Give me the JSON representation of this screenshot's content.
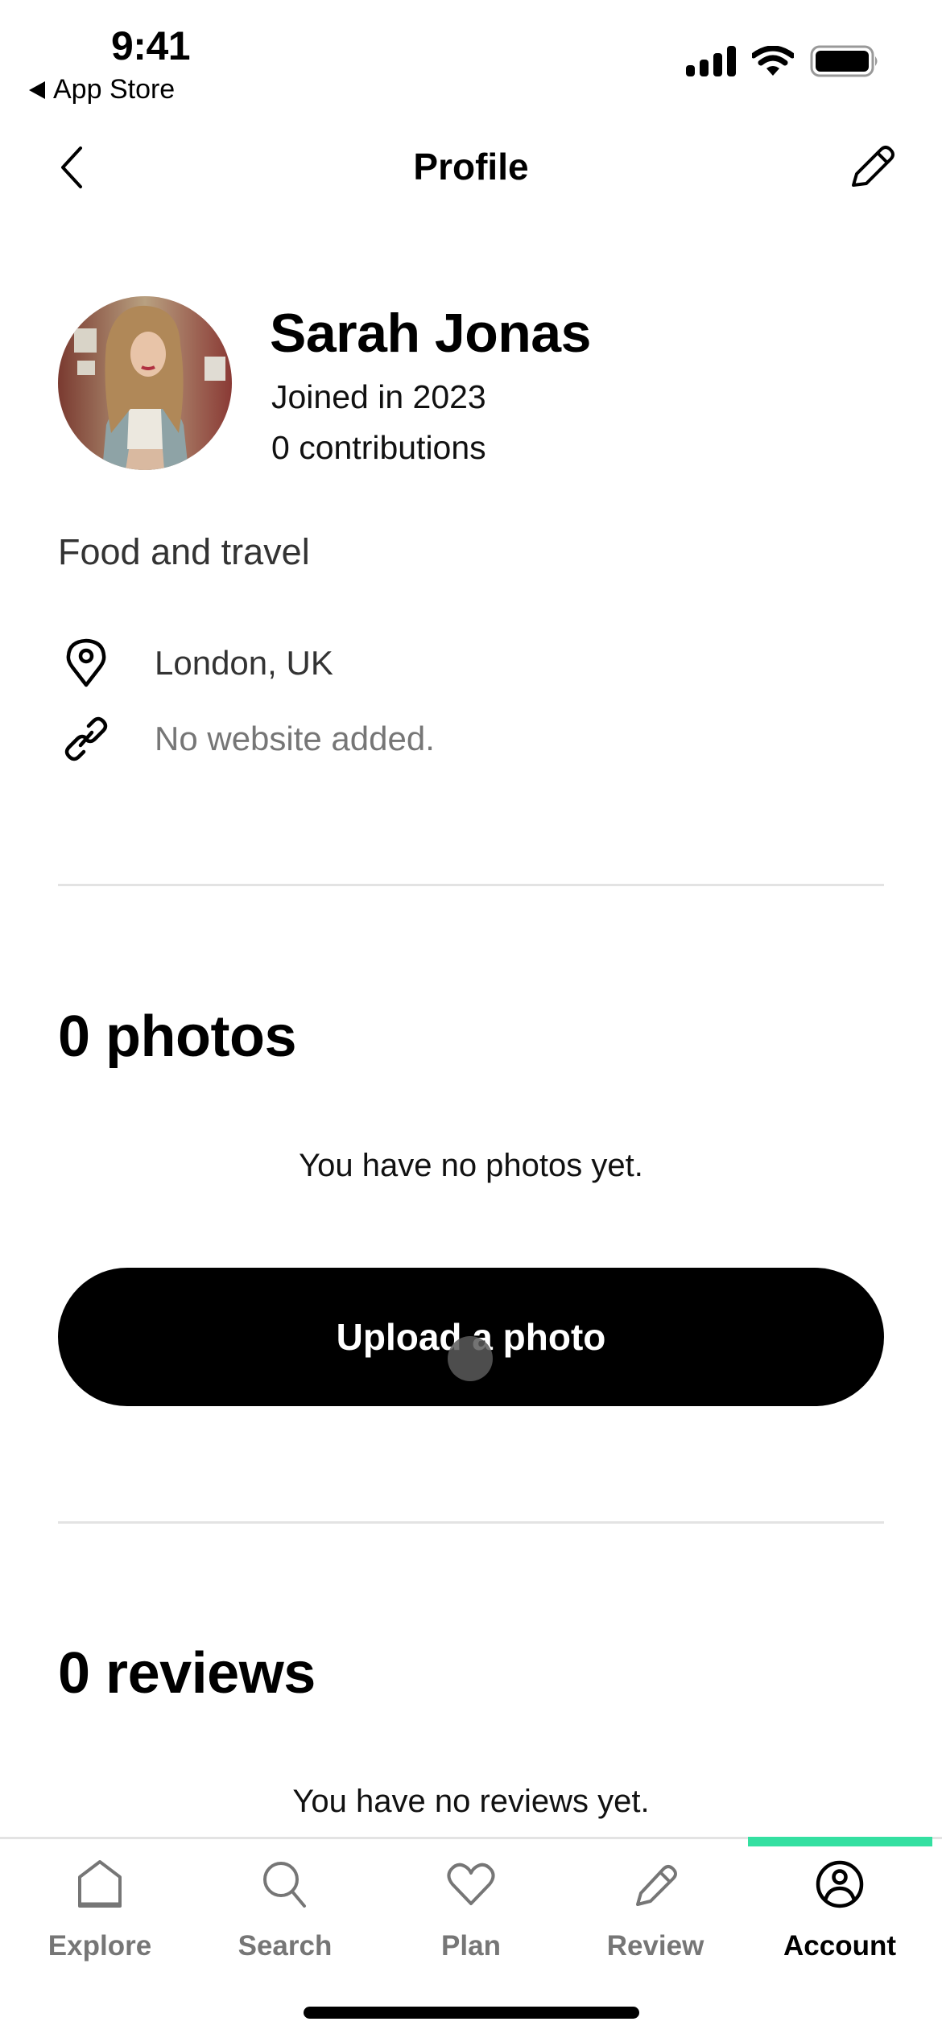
{
  "status_bar": {
    "time": "9:41",
    "back_app": "App Store",
    "icons": [
      "cellular-signal-icon",
      "wifi-icon",
      "battery-icon"
    ]
  },
  "header": {
    "title": "Profile",
    "back_icon": "chevron-left-icon",
    "edit_icon": "pencil-icon"
  },
  "profile": {
    "name": "Sarah Jonas",
    "joined": "Joined in 2023",
    "contributions": "0 contributions",
    "bio": "Food and travel",
    "location": "London, UK",
    "website": "No website added."
  },
  "photos": {
    "title": "0 photos",
    "empty_message": "You have no photos yet.",
    "upload_label": "Upload a photo"
  },
  "reviews": {
    "title": "0 reviews",
    "empty_message": "You have no reviews yet."
  },
  "tab_bar": {
    "active_index": 4,
    "accent_color": "#34E0A1",
    "items": [
      {
        "label": "Explore",
        "icon": "home-icon"
      },
      {
        "label": "Search",
        "icon": "search-icon"
      },
      {
        "label": "Plan",
        "icon": "heart-icon"
      },
      {
        "label": "Review",
        "icon": "pencil-icon"
      },
      {
        "label": "Account",
        "icon": "account-icon"
      }
    ]
  },
  "colors": {
    "text_primary": "#000000",
    "text_secondary": "#767676",
    "divider": "#e3e3e3",
    "button_bg": "#000000",
    "accent": "#34E0A1"
  }
}
